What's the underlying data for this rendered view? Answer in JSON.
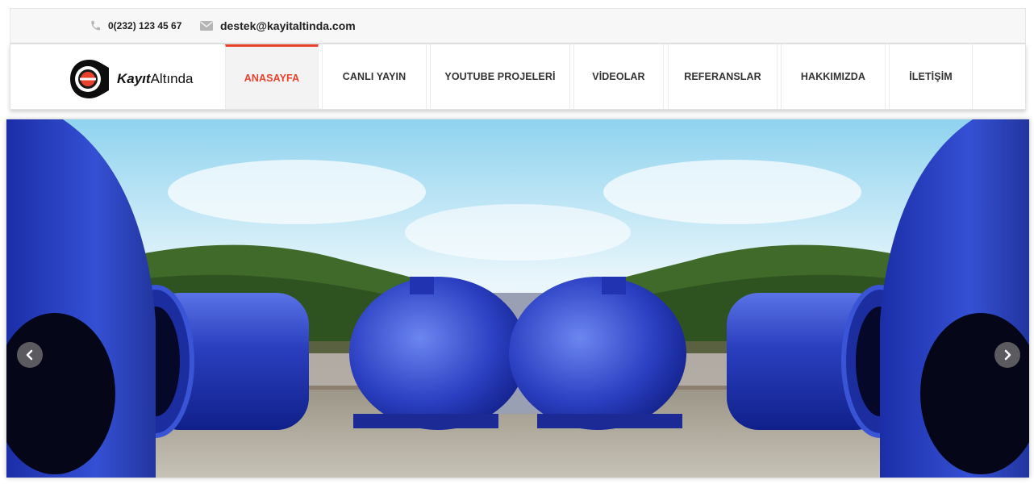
{
  "topbar": {
    "phone": {
      "icon": "phone-icon",
      "text": "0(232) 123 45 67"
    },
    "email": {
      "icon": "envelope-icon",
      "text": "destek@kayitaltinda.com"
    }
  },
  "logo": {
    "bold_text": "Kayıt",
    "light_text": "Altında",
    "accent_color": "#e8412c"
  },
  "nav": {
    "items": [
      {
        "label": "ANASAYFA",
        "active": true
      },
      {
        "label": "CANLI YAYIN"
      },
      {
        "label": "YOUTUBE PROJELERİ"
      },
      {
        "label": "VİDEOLAR"
      },
      {
        "label": "REFERANSLAR"
      },
      {
        "label": "HAKKIMIZDA"
      },
      {
        "label": "İLETİŞİM"
      }
    ],
    "active_color": "#e8412c"
  },
  "slider": {
    "prev_icon": "chevron-left-icon",
    "next_icon": "chevron-right-icon",
    "image_subject": "blue industrial cyclone tanks",
    "tank_color": "#2a3fbf"
  }
}
